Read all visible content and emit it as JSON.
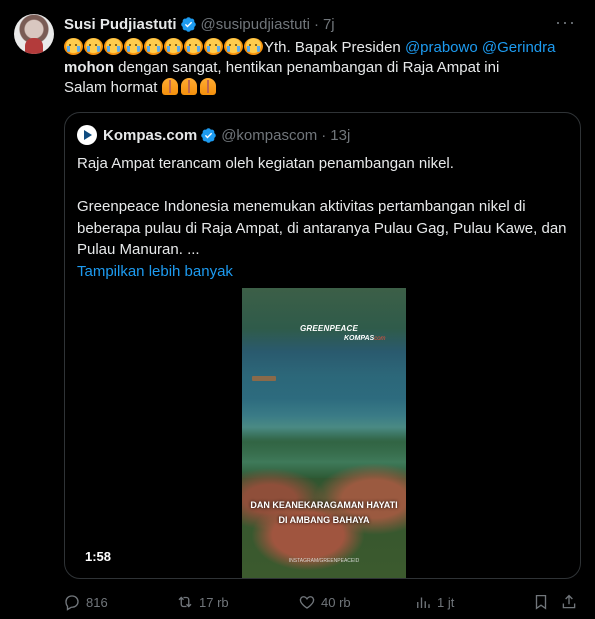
{
  "tweet": {
    "author_name": "Susi Pudjiastuti",
    "author_handle": "@susipudjiastuti",
    "separator": "·",
    "time": "7j",
    "body": {
      "mention1": "@prabowo",
      "mention2": "@Gerindra",
      "line1_text": "Yth. Bapak Presiden",
      "bold_word": "mohon",
      "line2_rest": " dengan sangat, hentikan penambangan di Raja Ampat ini",
      "line3": "Salam hormat"
    },
    "emoji": {
      "crying_count": 10,
      "pray_count": 3
    }
  },
  "quote": {
    "author_name": "Kompas.com",
    "author_handle": "@kompascom",
    "separator": "·",
    "time": "13j",
    "paragraph1": "Raja Ampat terancam oleh kegiatan penambangan nikel.",
    "paragraph2": "Greenpeace Indonesia menemukan aktivitas pertambangan nikel di beberapa pulau di Raja Ampat, di antaranya Pulau Gag, Pulau Kawe, dan Pulau Manuran. ...",
    "show_more": "Tampilkan lebih banyak",
    "video": {
      "watermark_greenpeace": "GREENPEACE",
      "watermark_kompas": "KOMPAS",
      "watermark_kompas_suffix": "com",
      "caption_line1": "DAN KEANEKARAGAMAN HAYATI",
      "caption_line2": "DI AMBANG BAHAYA",
      "credit": "INSTAGRAM/GREENPEACEID",
      "duration": "1:58"
    }
  },
  "actions": {
    "replies": "816",
    "reposts": "17 rb",
    "likes": "40 rb",
    "views": "1 jt"
  },
  "colors": {
    "accent": "#1d9bf0",
    "muted": "#71767b",
    "text": "#e7e9ea",
    "background": "#000000",
    "border": "#2f3336"
  }
}
